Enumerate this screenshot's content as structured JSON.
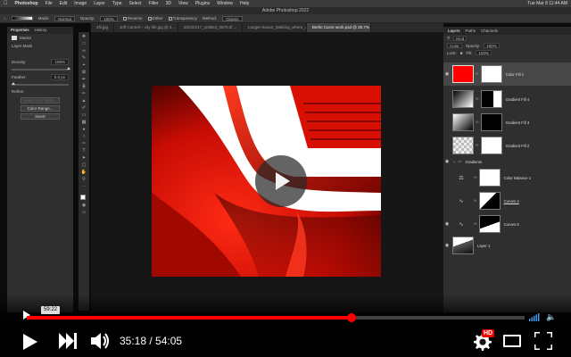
{
  "menubar": {
    "app": "Photoshop",
    "items": [
      "File",
      "Edit",
      "Image",
      "Layer",
      "Type",
      "Select",
      "Filter",
      "3D",
      "View",
      "Plugins",
      "Window",
      "Help"
    ],
    "clock": "Tue Mar 8  11:44 AM"
  },
  "window_title": "Adobe Photoshop 2022",
  "options": {
    "mode_label": "Mode:",
    "mode_value": "Normal",
    "opacity_label": "Opacity:",
    "opacity_value": "100%",
    "reverse": "Reverse",
    "dither": "Dither",
    "transparency": "Transparency",
    "method_label": "Method:",
    "method_value": "Classic"
  },
  "tabs": [
    {
      "label": "4fil.jpg"
    },
    {
      "label": "Jeff Carnell – city life.jpg @ 3..."
    },
    {
      "label": "20220217_untitled_0679.tif ..."
    },
    {
      "label": "Langer-Susan_Walking_where_others_walked_11_of_11.jpg"
    },
    {
      "label": "Berlin Curve work.psd @ 26.7% (Color Fill 1, RGB/16) *",
      "active": true
    }
  ],
  "properties": {
    "tab_properties": "Properties",
    "tab_history": "History",
    "section": "Masks",
    "mask_label": "Layer Mask",
    "density_label": "Density:",
    "density_value": "100%",
    "feather_label": "Feather:",
    "feather_value": "0.0 px",
    "refine_label": "Refine:",
    "select_mask": "Select and Mask...",
    "color_range": "Color Range...",
    "invert": "Invert"
  },
  "layers_panel": {
    "tab_layers": "Layers",
    "tab_paths": "Paths",
    "tab_channels": "Channels",
    "kind_label": "Kind",
    "blend_mode": "Color",
    "opacity_label": "Opacity:",
    "opacity_value": "100%",
    "lock_label": "Lock:",
    "fill_label": "Fill:",
    "fill_value": "100%",
    "layers": [
      {
        "name": "Color Fill 1",
        "selected": true
      },
      {
        "name": "Gradient Fill 4"
      },
      {
        "name": "Gradient Fill 3"
      },
      {
        "name": "Gradient Fill 2"
      },
      {
        "name": "Gradients",
        "group": true
      },
      {
        "name": "Color Balance 1"
      },
      {
        "name": "Curves 2",
        "underline": true
      },
      {
        "name": "Curves 6"
      },
      {
        "name": "Layer 1"
      }
    ]
  },
  "player": {
    "hover_time": "59:22",
    "current_time": "35:18",
    "duration": "54:05",
    "progress_fraction": 0.653,
    "hd_badge": "HD"
  },
  "colors": {
    "accent_red": "#ff0000",
    "art_red": "#e01408"
  }
}
